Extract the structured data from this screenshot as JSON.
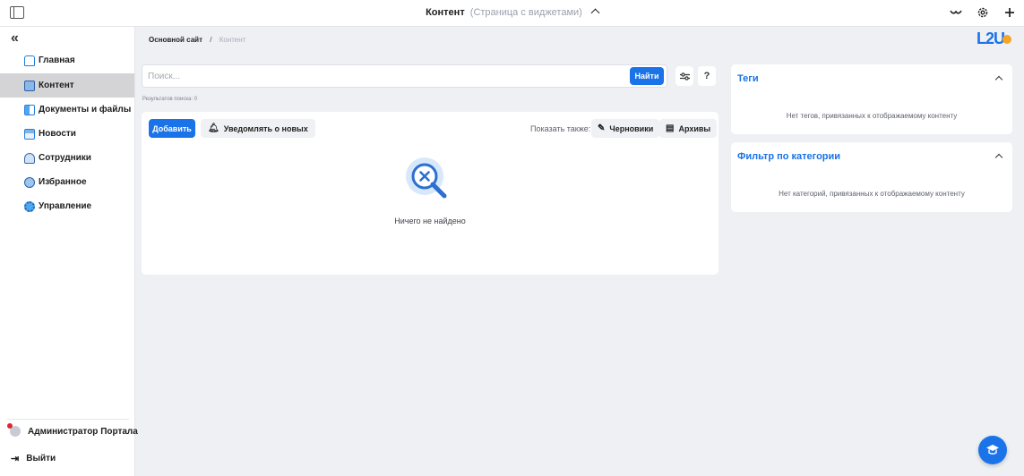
{
  "header": {
    "title": "Контент",
    "subtitle": "(Страница с виджетами)"
  },
  "sidebar": {
    "items": [
      {
        "label": "Главная",
        "icon": "home-icon"
      },
      {
        "label": "Контент",
        "icon": "content-icon",
        "active": true
      },
      {
        "label": "Документы и файлы",
        "icon": "documents-icon"
      },
      {
        "label": "Новости",
        "icon": "news-icon"
      },
      {
        "label": "Сотрудники",
        "icon": "employees-icon"
      },
      {
        "label": "Избранное",
        "icon": "favorites-icon"
      },
      {
        "label": "Управление",
        "icon": "management-icon"
      }
    ],
    "user_name": "Администратор Портала",
    "logout_label": "Выйти"
  },
  "breadcrumb": {
    "root": "Основной сайт",
    "separator": "/",
    "current": "Контент"
  },
  "logo": {
    "text": "L2U"
  },
  "search": {
    "placeholder": "Поиск...",
    "value": "",
    "button_label": "Найти",
    "results_label": "Результатов поиска: 0"
  },
  "toolbar": {
    "add_label": "Добавить",
    "notify_label": "Уведомлять о новых",
    "show_also_label": "Показать также:",
    "drafts_label": "Черновики",
    "archives_label": "Архивы",
    "help_label": "?"
  },
  "main": {
    "empty_text": "Ничего не найдено"
  },
  "widgets": {
    "tags": {
      "title": "Теги",
      "empty_text": "Нет тегов, привязанных к отображаемому контенту"
    },
    "category_filter": {
      "title": "Фильтр по категории",
      "empty_text": "Нет категорий, привязанных к отображаемому контенту"
    }
  },
  "colors": {
    "accent": "#1a73e8",
    "background": "#eef0f4",
    "active_nav": "#d4d4d7"
  }
}
